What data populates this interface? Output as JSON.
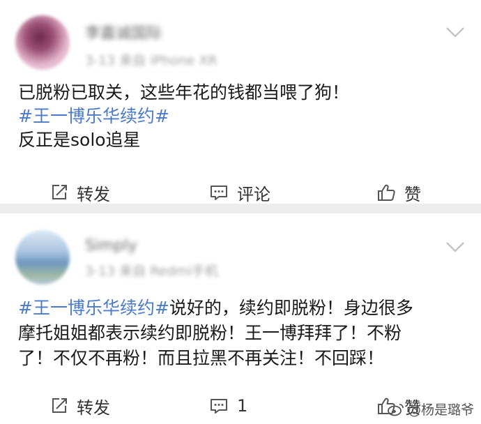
{
  "posts": [
    {
      "username": "李嘉诚国际",
      "meta": "3-13 来自 iPhone XR",
      "lines": [
        {
          "parts": [
            {
              "text": "已脱粉已取关，这些年花的钱都当喂了狗！",
              "topic": false
            }
          ]
        },
        {
          "parts": [
            {
              "text": "#王一博乐华续约#",
              "topic": true
            }
          ]
        },
        {
          "parts": [
            {
              "text": "反正是solo追星",
              "topic": false
            }
          ]
        }
      ],
      "actions": {
        "repost": "转发",
        "comment": "评论",
        "like": "赞"
      }
    },
    {
      "username": "Simply",
      "meta": "3-13 来自 Redmi手机",
      "lines": [
        {
          "parts": [
            {
              "text": "#王一博乐华续约#",
              "topic": true
            },
            {
              "text": "说好的，续约即脱粉！身边很多",
              "topic": false
            }
          ]
        },
        {
          "parts": [
            {
              "text": "摩托姐姐都表示续约即脱粉！王一博拜拜了！不粉",
              "topic": false
            }
          ]
        },
        {
          "parts": [
            {
              "text": "了！不仅不再粉！而且拉黑不再关注！不回踩！",
              "topic": false
            }
          ]
        }
      ],
      "actions": {
        "repost": "转发",
        "comment": "1",
        "like": "赞"
      }
    }
  ],
  "watermark": "@杨是璐爷",
  "icons": {
    "repost": "repost-icon",
    "comment": "comment-icon",
    "like": "thumbs-up-icon",
    "more": "chevron-down-icon",
    "weibo": "weibo-logo-icon"
  },
  "colors": {
    "topic": "#4b7bc8",
    "separator": "#ededed"
  }
}
